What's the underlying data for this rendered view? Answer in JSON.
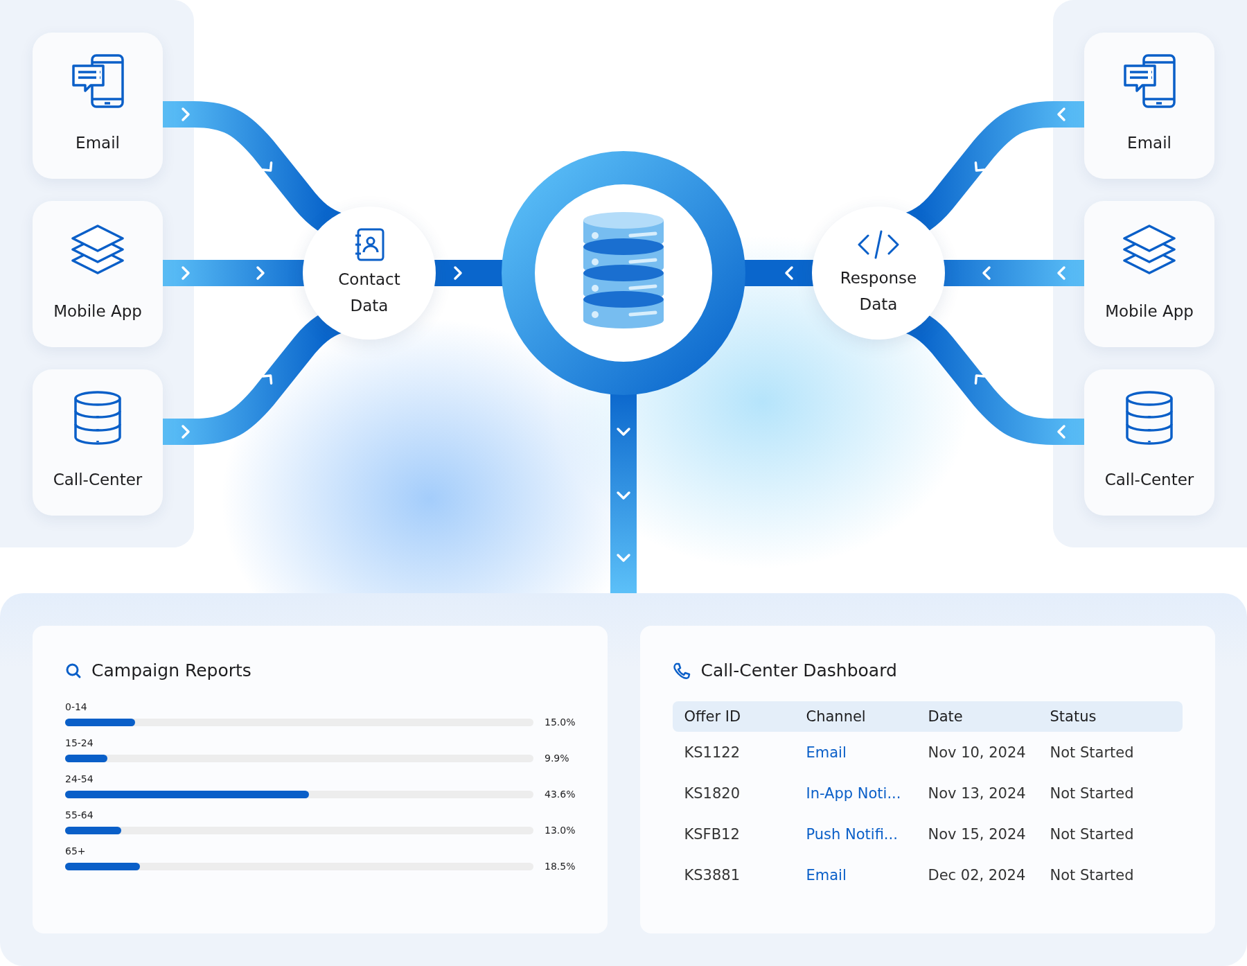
{
  "sources": [
    {
      "kind": "chat-phone",
      "label": "Email"
    },
    {
      "kind": "layers",
      "label": "Mobile App"
    },
    {
      "kind": "database",
      "label": "Call-Center"
    }
  ],
  "contact_node": {
    "label": "Contact Data"
  },
  "response_node": {
    "label": "Response Data"
  },
  "destinations": [
    {
      "kind": "chat-phone",
      "label": "Email"
    },
    {
      "kind": "layers",
      "label": "Mobile App"
    },
    {
      "kind": "database",
      "label": "Call-Center"
    }
  ],
  "campaign_reports": {
    "title": "Campaign Reports",
    "bars": [
      {
        "label": "0-14",
        "level": 0.15,
        "reading": "15.0%"
      },
      {
        "label": "15-24",
        "level": 0.09,
        "reading": "9.9%"
      },
      {
        "label": "24-54",
        "level": 0.52,
        "reading": "43.6%"
      },
      {
        "label": "55-64",
        "level": 0.12,
        "reading": "13.0%"
      },
      {
        "label": "65+",
        "level": 0.16,
        "reading": "18.5%"
      }
    ]
  },
  "call_center_dashboard": {
    "title": "Call-Center Dashboard",
    "columns": [
      "Offer ID",
      "Channel",
      "Date",
      "Status"
    ],
    "rows": [
      {
        "offer_id": "KS1122",
        "channel": "Email",
        "date": "Nov 10, 2024",
        "status": "Not Started"
      },
      {
        "offer_id": "KS1820",
        "channel": "In-App Noti...",
        "date": "Nov 13, 2024",
        "status": "Not Started"
      },
      {
        "offer_id": "KSFB12",
        "channel": "Push Notifi...",
        "date": "Nov 15, 2024",
        "status": "Not Started"
      },
      {
        "offer_id": "KS3881",
        "channel": "Email",
        "date": "Dec 02, 2024",
        "status": "Not Started"
      }
    ]
  }
}
